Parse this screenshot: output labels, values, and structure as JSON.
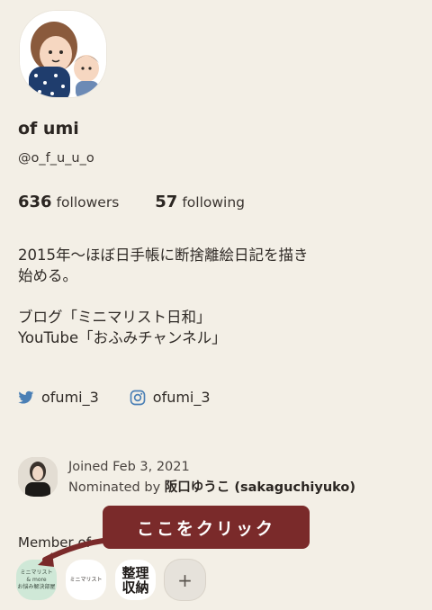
{
  "profile": {
    "display_name": "of umi",
    "handle": "@o_f_u_u_o",
    "followers_count": "636",
    "followers_label": "followers",
    "following_count": "57",
    "following_label": "following",
    "bio_line1": "2015年〜ほぼ日手帳に断捨離絵日記を描き\n始める。",
    "bio_line2": "ブログ「ミニマリスト日和」\nYouTube「おふみチャンネル」"
  },
  "social": {
    "twitter": "ofumi_3",
    "instagram": "ofumi_3"
  },
  "joined": {
    "date_text": "Joined Feb 3, 2021",
    "nominated_prefix": "Nominated by",
    "nominator": "阪口ゆうこ (sakaguchiyuko)"
  },
  "member_of_label": "Member of",
  "groups": [
    {
      "label": "ミニマリスト\n& more\nお悩み解決部屋"
    },
    {
      "label": "ミニマリスト"
    },
    {
      "label": "整理\n収納"
    },
    {
      "label": "+"
    }
  ],
  "callout_text": "ここをクリック",
  "colors": {
    "background": "#f3efe6",
    "callout": "#7a2a2a",
    "twitter": "#4a7fb5",
    "instagram": "#4a7fb5"
  },
  "icons": [
    "twitter-icon",
    "instagram-icon",
    "add-icon"
  ]
}
